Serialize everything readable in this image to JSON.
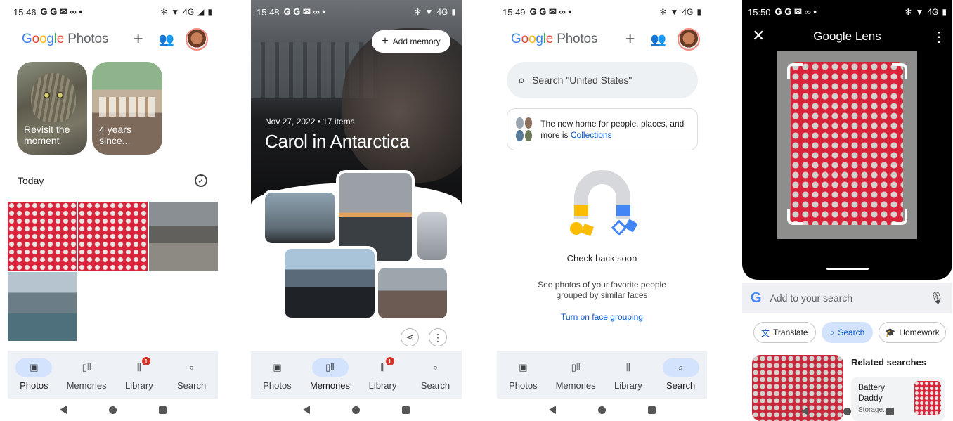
{
  "screens": {
    "s1": {
      "status": {
        "time": "15:46",
        "icons": "G G ✉ ∞ •",
        "right": "4G"
      },
      "logo": {
        "google": [
          "G",
          "o",
          "o",
          "g",
          "l",
          "e"
        ],
        "photos": "Photos"
      },
      "memories": [
        {
          "label": "Revisit the moment"
        },
        {
          "label": "4 years since..."
        }
      ],
      "section_title": "Today"
    },
    "s2": {
      "status": {
        "time": "15:48",
        "icons": "G G ✉ ∞ •",
        "right": "4G"
      },
      "add_memory": "Add memory",
      "meta": "Nov 27, 2022 • 17 items",
      "title": "Carol in Antarctica"
    },
    "s3": {
      "status": {
        "time": "15:49",
        "icons": "G G ✉ ∞ •",
        "right": "4G"
      },
      "logo": {
        "google": [
          "G",
          "o",
          "o",
          "g",
          "l",
          "e"
        ],
        "photos": "Photos"
      },
      "search_placeholder": "Search \"United States\"",
      "collections_text": "The new home for people, places, and more is ",
      "collections_link": "Collections",
      "empty_title": "Check back soon",
      "empty_desc": "See photos of your favorite people grouped by similar faces",
      "face_grouping": "Turn on face grouping"
    },
    "s4": {
      "status": {
        "time": "15:50",
        "icons": "G G ✉ ∞ •",
        "right": "4G"
      },
      "title": "Google Lens",
      "search_placeholder": "Add to your search",
      "chips": [
        "Translate",
        "Search",
        "Homework"
      ],
      "related_title": "Related searches",
      "related_item": "Battery Daddy",
      "related_sub": "Storage..."
    }
  },
  "nav": {
    "tabs": [
      "Photos",
      "Memories",
      "Library",
      "Search"
    ],
    "badge": "1"
  },
  "colors": {
    "nav_bg": "#eef1f6",
    "active_pill": "#d3e3fd",
    "link_blue": "#0b57d0",
    "red_case": "#d9233a"
  }
}
